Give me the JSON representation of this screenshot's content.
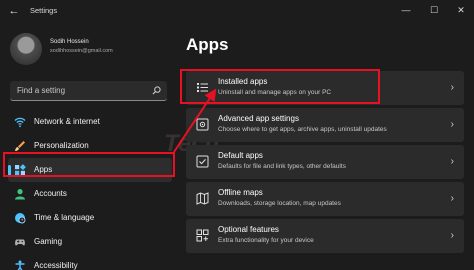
{
  "titlebar": {
    "back_glyph": "←",
    "title": "Settings",
    "minimize_glyph": "—",
    "maximize_glyph": "☐",
    "close_glyph": "✕"
  },
  "profile": {
    "name": "Sodih Hossein",
    "email": "sodihhossein@gmail.com"
  },
  "search": {
    "placeholder": "Find a setting",
    "icon": "search-icon"
  },
  "nav": {
    "items": [
      {
        "label": "Network & internet",
        "icon": "wifi-icon",
        "color": "#4cc2ff"
      },
      {
        "label": "Personalization",
        "icon": "brush-icon",
        "color": "#ff9c4c"
      },
      {
        "label": "Apps",
        "icon": "apps-icon",
        "color": "#9ad6ff"
      },
      {
        "label": "Accounts",
        "icon": "person-icon",
        "color": "#3ec47e"
      },
      {
        "label": "Time & language",
        "icon": "globe-clock-icon",
        "color": "#4cc2ff"
      },
      {
        "label": "Gaming",
        "icon": "gamepad-icon",
        "color": "#b0b0b0"
      },
      {
        "label": "Accessibility",
        "icon": "accessibility-icon",
        "color": "#4cc2ff"
      }
    ],
    "active_index": 2,
    "accent": "#4cc2ff"
  },
  "main": {
    "heading": "Apps",
    "cards": [
      {
        "title": "Installed apps",
        "subtitle": "Uninstall and manage apps on your PC",
        "icon": "list-icon"
      },
      {
        "title": "Advanced app settings",
        "subtitle": "Choose where to get apps, archive apps, uninstall updates",
        "icon": "app-settings-icon"
      },
      {
        "title": "Default apps",
        "subtitle": "Defaults for file and link types, other defaults",
        "icon": "default-apps-icon"
      },
      {
        "title": "Offline maps",
        "subtitle": "Downloads, storage location, map updates",
        "icon": "map-icon"
      },
      {
        "title": "Optional features",
        "subtitle": "Extra functionality for your device",
        "icon": "features-icon"
      }
    ],
    "chevron": "›"
  },
  "annotation": {
    "highlight_color": "#e81123"
  },
  "watermark": {
    "text": "Tech"
  }
}
